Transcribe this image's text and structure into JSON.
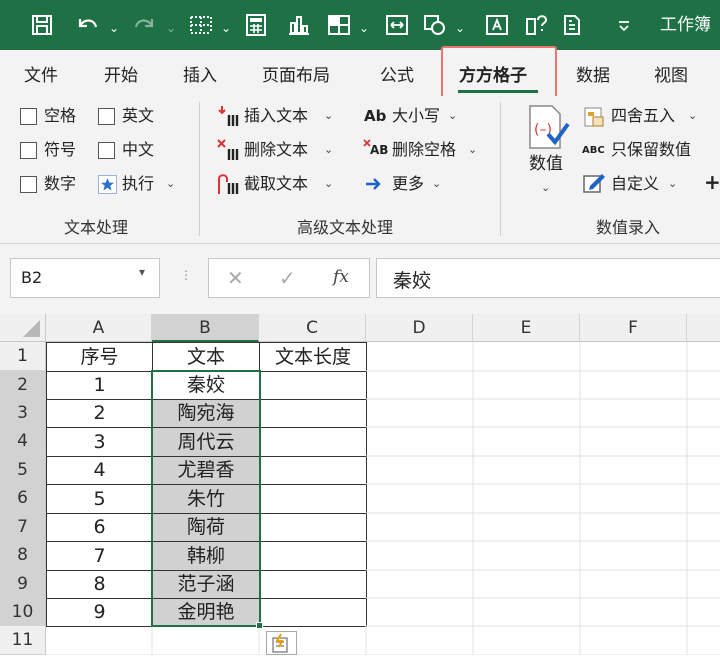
{
  "title_bar": {
    "document_title": "工作簿"
  },
  "tabs": [
    "文件",
    "开始",
    "插入",
    "页面布局",
    "公式",
    "方方格子",
    "数据",
    "视图"
  ],
  "ribbon": {
    "text_processing": {
      "group_label": "文本处理",
      "checkboxes": [
        "空格",
        "英文",
        "符号",
        "中文",
        "数字"
      ],
      "execute_label": "执行"
    },
    "advanced_text": {
      "group_label": "高级文本处理",
      "insert_text": "插入文本",
      "delete_text": "删除文本",
      "extract_text": "截取文本",
      "case_icon_text": "Ab",
      "case_label": "大小写",
      "delete_space_icon_text": "AB",
      "delete_space_label": "删除空格",
      "more_label": "更多"
    },
    "numeric_entry": {
      "group_label": "数值录入",
      "value_label": "数值",
      "round_label": "四舍五入",
      "keep_numbers_icon_text": "ABC",
      "keep_numbers_label": "只保留数值",
      "custom_label": "自定义"
    }
  },
  "formula_bar": {
    "name_box": "B2",
    "fx": "fx",
    "content": "秦姣"
  },
  "sheet": {
    "columns": [
      "A",
      "B",
      "C",
      "D",
      "E",
      "F"
    ],
    "rows": [
      "1",
      "2",
      "3",
      "4",
      "5",
      "6",
      "7",
      "8",
      "9",
      "10",
      "11"
    ],
    "header_row": [
      "序号",
      "文本",
      "文本长度"
    ],
    "data": [
      [
        "1",
        "秦姣"
      ],
      [
        "2",
        "陶宛海"
      ],
      [
        "3",
        "周代云"
      ],
      [
        "4",
        "尤碧香"
      ],
      [
        "5",
        "朱竹"
      ],
      [
        "6",
        "陶荷"
      ],
      [
        "7",
        "韩柳"
      ],
      [
        "8",
        "范子涵"
      ],
      [
        "9",
        "金明艳"
      ]
    ]
  },
  "colors": {
    "brand_green": "#1e7145",
    "active_tab_highlight": "#e8776f",
    "selection_gray": "#d1d1d1"
  }
}
